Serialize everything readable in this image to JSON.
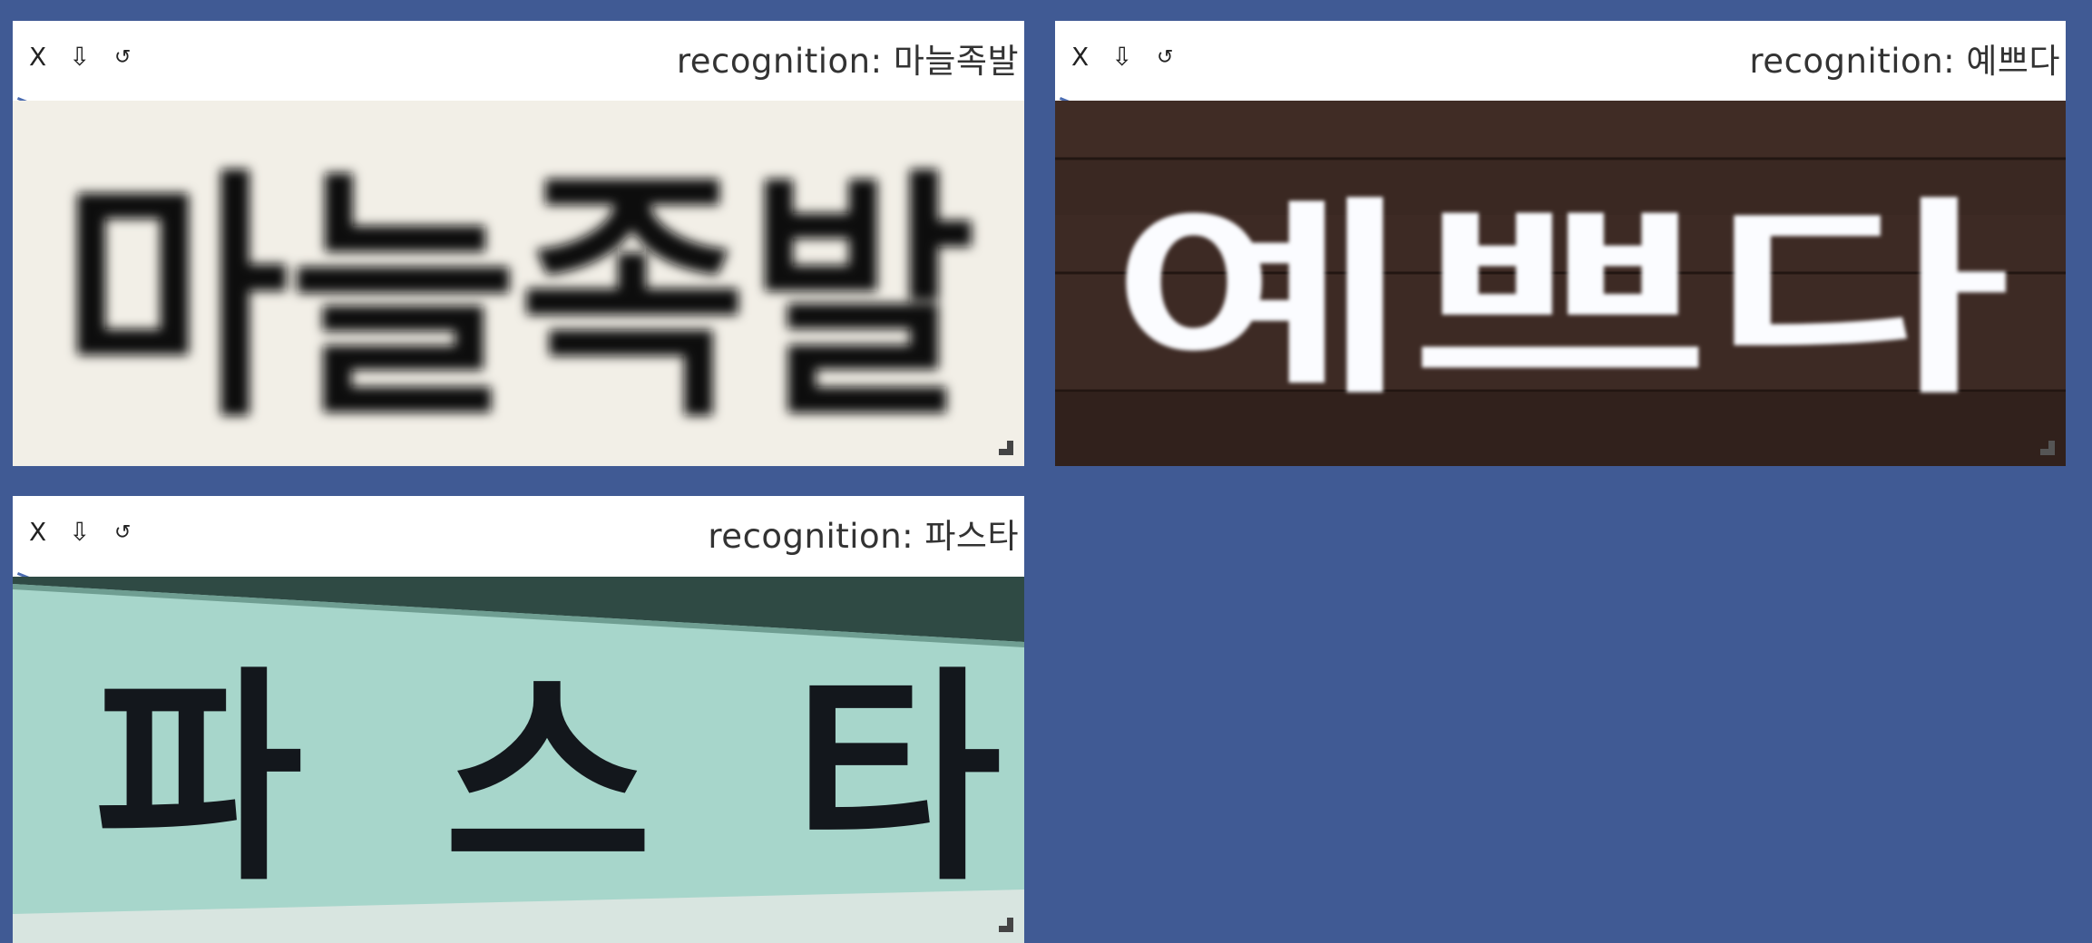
{
  "colors": {
    "background": "#405a94",
    "panel": "#ffffff",
    "corner_accent": "#4a6bb0"
  },
  "panels": [
    {
      "close_label": "X",
      "download_icon": "download-arrow-icon",
      "reset_icon": "reset-view-icon",
      "title": "recognition: 마늘족발",
      "image_text": "마늘족발",
      "image_colors": {
        "bg": "#efece4",
        "fg": "#0c0c0c"
      }
    },
    {
      "close_label": "X",
      "download_icon": "download-arrow-icon",
      "reset_icon": "reset-view-icon",
      "title": "recognition: 예쁘다",
      "image_text": "예쁘다",
      "image_colors": {
        "bg": "#3d2a24",
        "fg": "#fbfcff"
      }
    },
    {
      "close_label": "X",
      "download_icon": "download-arrow-icon",
      "reset_icon": "reset-view-icon",
      "title": "recognition: 파스타",
      "image_text": "파스타",
      "image_colors": {
        "bg": "#a7d6cb",
        "fg": "#13171c"
      }
    }
  ]
}
